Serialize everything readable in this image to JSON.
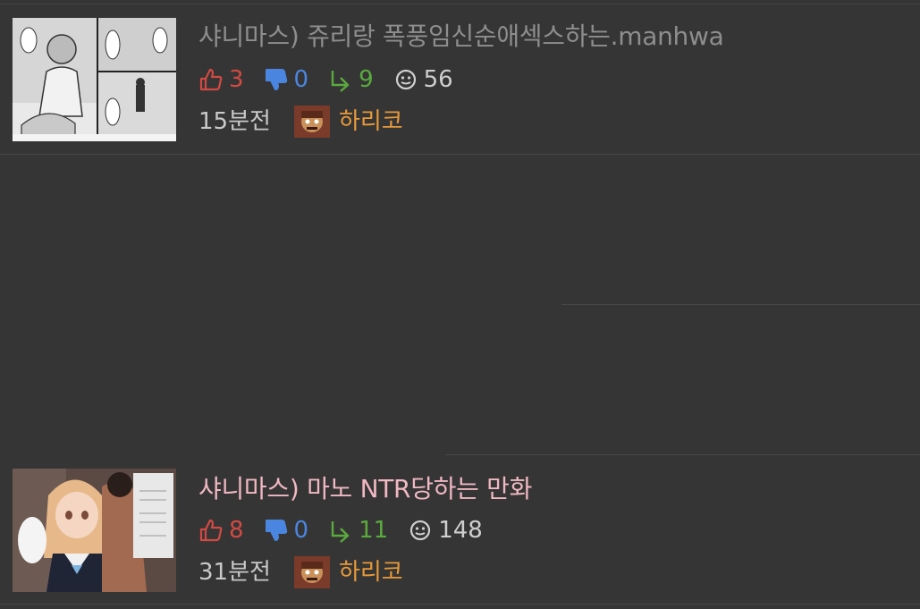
{
  "posts": [
    {
      "title": "샤니마스) 쥬리랑 폭풍임신순애섹스하는.manhwa",
      "upvotes": "3",
      "downvotes": "0",
      "replies": "9",
      "views": "56",
      "time": "15분전",
      "author": "하리코",
      "title_color": "#8e8e8e"
    },
    {
      "title": "샤니마스) 마노 NTR당하는 만화",
      "upvotes": "8",
      "downvotes": "0",
      "replies": "11",
      "views": "148",
      "time": "31분전",
      "author": "하리코",
      "title_color": "#f0b8c2"
    }
  ],
  "colors": {
    "background": "#353535",
    "upvote": "#d24a43",
    "downvote": "#4a86e0",
    "reply": "#5aaa3e",
    "author": "#e89a3a"
  },
  "icons": {
    "upvote": "thumbs-up-icon",
    "downvote": "thumbs-down-icon",
    "reply": "reply-arrow-icon",
    "views": "eye-icon"
  }
}
